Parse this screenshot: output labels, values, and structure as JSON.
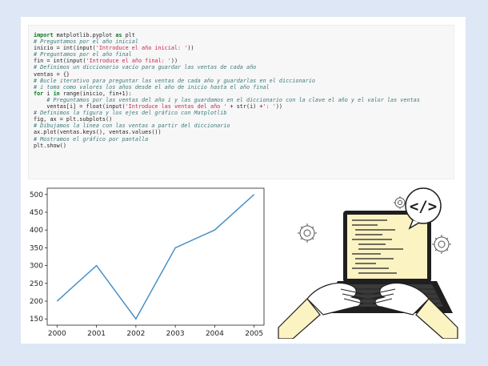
{
  "code": {
    "lines": [
      {
        "kind": "import",
        "parts": [
          "import",
          "matplotlib.pyplot",
          "as",
          "plt"
        ]
      },
      {
        "kind": "comment",
        "text": "# Preguntamos por el año inicial"
      },
      {
        "kind": "input",
        "pre": "inicio = int(input(",
        "str": "'Introduce el año inicial: '",
        "post": "))"
      },
      {
        "kind": "comment",
        "text": "# Preguntamos por el año final"
      },
      {
        "kind": "input",
        "pre": "fin = int(input(",
        "str": "'Introduce el año final: '",
        "post": "))"
      },
      {
        "kind": "comment",
        "text": "# Definimos un diccionario vacío para guardar las ventas de cada año"
      },
      {
        "kind": "plain",
        "text": "ventas = {}"
      },
      {
        "kind": "comment",
        "text": "# Bucle iterativo para preguntar las ventas de cada año y guardarlas en el diccionario"
      },
      {
        "kind": "comment",
        "text": "# i toma como valores los años desde el año de inicio hasta el año final"
      },
      {
        "kind": "for",
        "kw1": "for",
        "mid1": " i ",
        "kw2": "in",
        "rest": " range(inicio, fin+1):"
      },
      {
        "kind": "comment",
        "text": "    # Preguntamos por las ventas del año i y las guardamos en el diccionario con la clave el año y el valor las ventas"
      },
      {
        "kind": "input",
        "pre": "    ventas[i] = float(input(",
        "str": "'Introduce las ventas del año '",
        "post": " + str(i) +",
        "str2": "': '",
        "post2": "))"
      },
      {
        "kind": "comment",
        "text": "# Definimos la figura y los ejes del gráfico con Matplotlib"
      },
      {
        "kind": "plain",
        "text": "fig, ax = plt.subplots()"
      },
      {
        "kind": "comment",
        "text": "# Dibujamos la línea con las ventas a partir del diccionario"
      },
      {
        "kind": "plain",
        "text": "ax.plot(ventas.keys(), ventas.values())"
      },
      {
        "kind": "comment",
        "text": "# Mostramos el gráfico por pantalla"
      },
      {
        "kind": "plain",
        "text": "plt.show()"
      }
    ]
  },
  "chart_data": {
    "type": "line",
    "x": [
      2000,
      2001,
      2002,
      2003,
      2004,
      2005
    ],
    "y": [
      200,
      300,
      150,
      350,
      400,
      500
    ],
    "xticks": [
      "2000",
      "2001",
      "2002",
      "2003",
      "2004",
      "2005"
    ],
    "yticks": [
      "150",
      "200",
      "250",
      "300",
      "350",
      "400",
      "450",
      "500"
    ],
    "xlim": [
      1999.75,
      2005.25
    ],
    "ylim": [
      132.5,
      517.5
    ],
    "grid": false,
    "line_color": "#4a90c4"
  },
  "illustration": {
    "code_symbol": "</>",
    "colors": {
      "outline": "#1f1f1f",
      "screen": "#fcf3c3",
      "sleeve": "#fcf3c3",
      "bubble": "#ffffff"
    }
  }
}
